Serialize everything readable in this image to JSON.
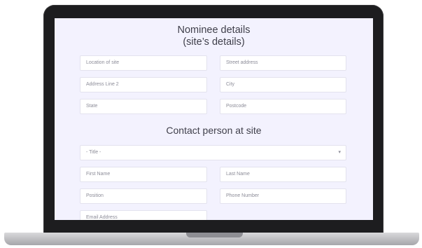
{
  "nominee": {
    "heading_line1": "Nominee details",
    "heading_line2": "(site’s details)",
    "fields": {
      "location_of_site": "Location of site",
      "street_address": "Street address",
      "address_line_2": "Address Line 2",
      "city": "City",
      "state": "State",
      "postcode": "Postcode"
    }
  },
  "contact": {
    "heading": "Contact person at site",
    "title_select": "- Title -",
    "chevron_icon": "chevron-down-icon",
    "fields": {
      "first_name": "First Name",
      "last_name": "Last Name",
      "position": "Position",
      "phone_number": "Phone Number",
      "email_address": "Email Address"
    }
  },
  "colors": {
    "screen_background": "#f3f2fe",
    "field_border": "#e3e2ee",
    "heading_text": "#3f3f4a",
    "placeholder_text": "#8c8c98"
  }
}
